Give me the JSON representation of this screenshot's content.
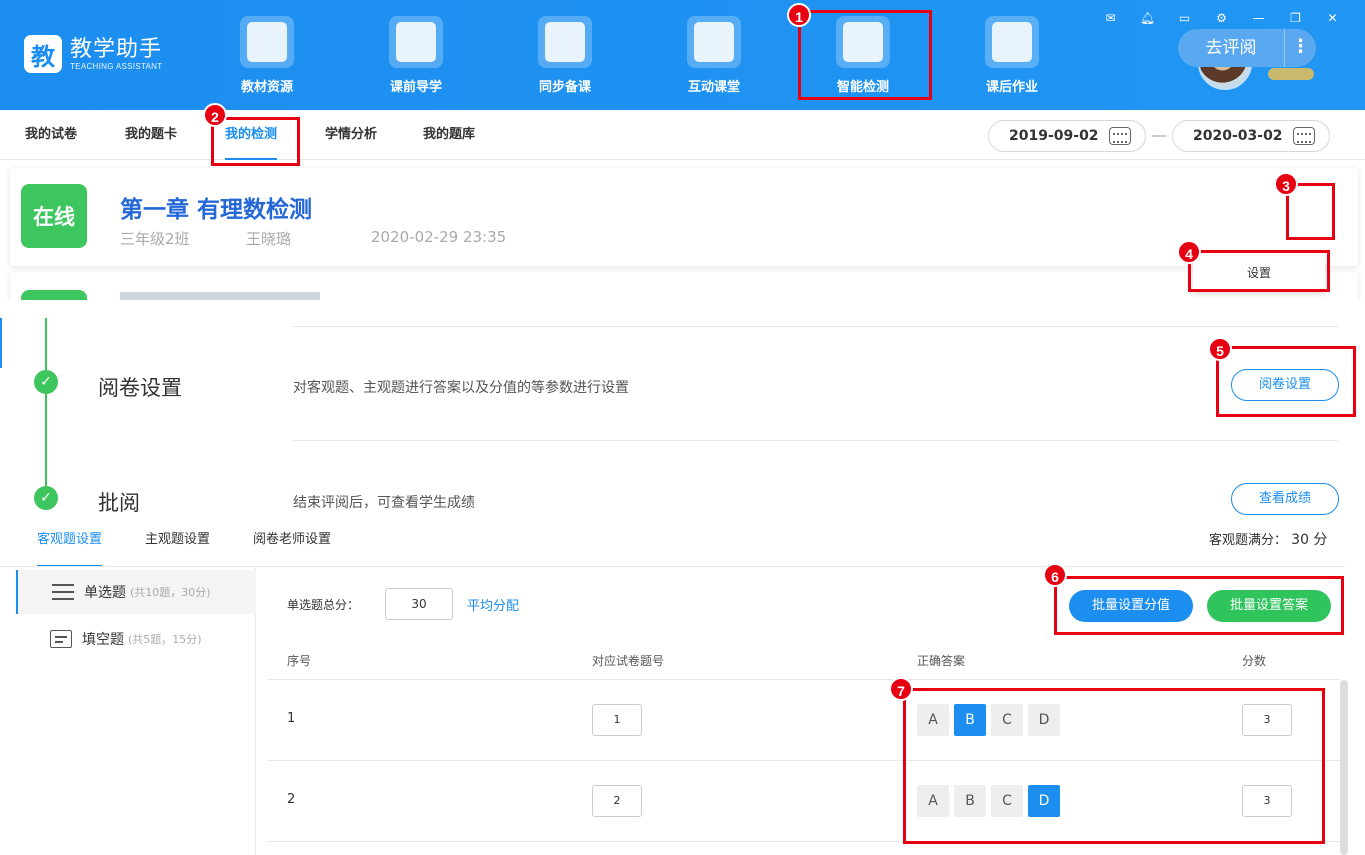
{
  "app": {
    "logo_char": "教",
    "name": "教学助手",
    "name_en": "TEACHING ASSISTANT"
  },
  "top_nav": [
    {
      "label": "教材资源",
      "icon": "folder-drawer-icon"
    },
    {
      "label": "课前导学",
      "icon": "upload-arrow-icon"
    },
    {
      "label": "同步备课",
      "icon": "pencil-document-icon"
    },
    {
      "label": "互动课堂",
      "icon": "monitor-icon"
    },
    {
      "label": "智能检测",
      "icon": "checklist-icon"
    },
    {
      "label": "课后作业",
      "icon": "backpack-icon"
    }
  ],
  "window_controls": [
    "mail-icon",
    "bell-icon",
    "chat-icon",
    "gear-icon",
    "minimize-icon",
    "restore-icon",
    "close-icon"
  ],
  "sub_tabs": [
    {
      "label": "我的试卷"
    },
    {
      "label": "我的题卡"
    },
    {
      "label": "我的检测"
    },
    {
      "label": "学情分析"
    },
    {
      "label": "我的题库"
    }
  ],
  "date_range": {
    "start": "2019-09-02",
    "end": "2020-03-02"
  },
  "card": {
    "badge": "在线",
    "title": "第一章 有理数检测",
    "class_name": "三年级2班",
    "teacher": "王晓璐",
    "datetime": "2020-02-29 23:35",
    "review_button": "去评阅",
    "more_button": "⋮",
    "dropdown_item": "设置"
  },
  "steps": [
    {
      "title": "阅卷设置",
      "desc": "对客观题、主观题进行答案以及分值的等参数进行设置",
      "button": "阅卷设置"
    },
    {
      "title": "批阅",
      "desc": "结束评阅后，可查看学生成绩",
      "button": "查看成绩"
    }
  ],
  "objective": {
    "tabs": [
      "客观题设置",
      "主观题设置",
      "阅卷老师设置"
    ],
    "full_score_label": "客观题满分：",
    "full_score_value": "30 分",
    "question_types": [
      {
        "label": "单选题",
        "sub": "(共10题，30分)"
      },
      {
        "label": "填空题",
        "sub": "(共5题，15分)"
      }
    ],
    "total_label": "单选题总分：",
    "total_value": "30",
    "average_link": "平均分配",
    "batch_score_button": "批量设置分值",
    "batch_answer_button": "批量设置答案",
    "columns": [
      "序号",
      "对应试卷题号",
      "正确答案",
      "分数"
    ],
    "rows": [
      {
        "index": "1",
        "paper_no": "1",
        "options": [
          "A",
          "B",
          "C",
          "D"
        ],
        "selected": "B",
        "score": "3"
      },
      {
        "index": "2",
        "paper_no": "2",
        "options": [
          "A",
          "B",
          "C",
          "D"
        ],
        "selected": "D",
        "score": "3"
      }
    ]
  },
  "annotations": [
    "1",
    "2",
    "3",
    "4",
    "5",
    "6",
    "7"
  ],
  "colors": {
    "primary": "#1c8ef0",
    "success": "#3dc55e",
    "annotation": "#e60012"
  }
}
